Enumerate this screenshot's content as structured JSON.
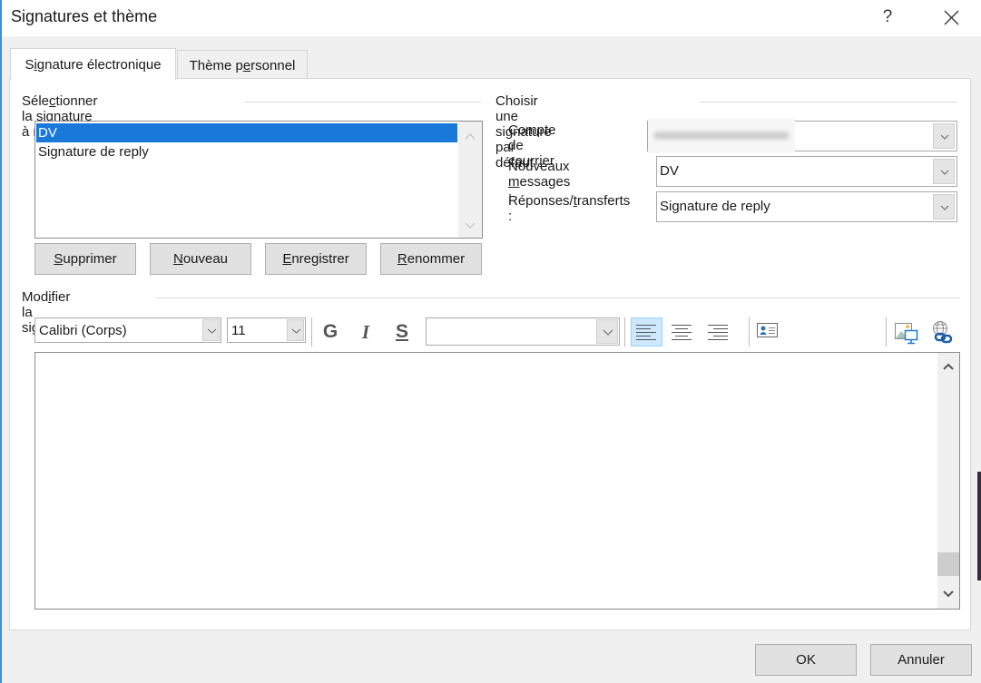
{
  "window": {
    "title": "Signatures et thème",
    "help_label": "?",
    "close_icon": "close-icon"
  },
  "tabs": [
    {
      "label_pre": "S",
      "label_u": "i",
      "label_post": "gnature électronique",
      "active": true
    },
    {
      "label_pre": "Thème p",
      "label_u": "e",
      "label_post": "rsonnel",
      "active": false
    }
  ],
  "select_signature": {
    "group_label_pre": "Séle",
    "group_label_u": "c",
    "group_label_post": "tionner la signature à modifier",
    "items": [
      {
        "label": "DV",
        "selected": true
      },
      {
        "label": "Signature de reply",
        "selected": false
      }
    ],
    "buttons": [
      {
        "u": "S",
        "rest": "upprimer"
      },
      {
        "u": "N",
        "rest": "ouveau"
      },
      {
        "u": "E",
        "rest": "nregistrer"
      },
      {
        "u": "R",
        "rest": "enommer"
      }
    ]
  },
  "default_signature": {
    "group_label": "Choisir une signature par défaut",
    "account": {
      "label_pre": "Compte de courr",
      "label_u": "i",
      "label_post": "er",
      "value": "(blurred email address)"
    },
    "new_messages": {
      "label_pre": "Nouveaux ",
      "label_u": "m",
      "label_post": "essages :",
      "value": "DV"
    },
    "replies": {
      "label_pre": "Réponses/",
      "label_u": "t",
      "label_post": "ransferts :",
      "value": "Signature de reply"
    }
  },
  "edit_signature": {
    "group_label_pre": "Mod",
    "group_label_u": "i",
    "group_label_post": "fier la signature",
    "toolbar": {
      "font": "Calibri (Corps)",
      "size": "11",
      "bold_label": "G",
      "italic_label": "I",
      "underline_label": "S",
      "color_value": "",
      "align": [
        "align-left",
        "align-center",
        "align-right"
      ],
      "align_active": "align-left",
      "vcard_u": "C",
      "vcard_rest": "arte de visite",
      "insert_picture_icon": "insert-picture-icon",
      "insert_link_icon": "insert-hyperlink-icon"
    },
    "content": ""
  },
  "footer": {
    "ok_label": "OK",
    "cancel_label": "Annuler"
  },
  "colors": {
    "selection": "#1979d9",
    "align_active_bg": "#cce8ff",
    "button_bg": "#e1e1e1",
    "window_bg": "#f0f0f0"
  }
}
